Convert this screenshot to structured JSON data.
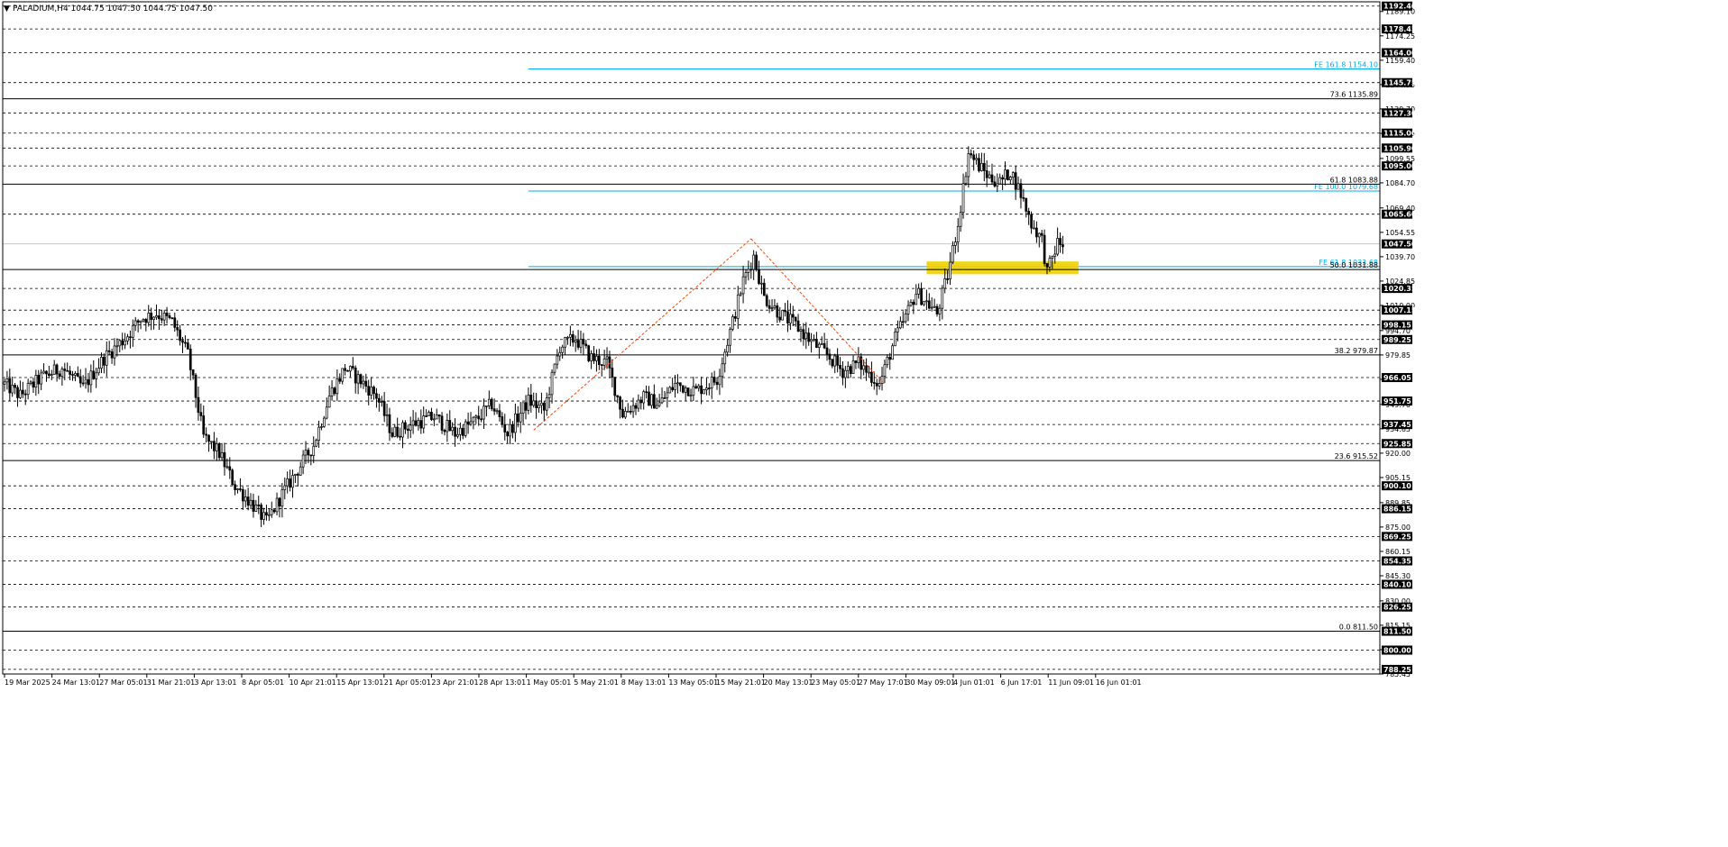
{
  "header": {
    "arrow_glyph": "▼",
    "symbol_text": "PALADIUM,H4  1044.75 1047.50 1044.75 1047.50"
  },
  "colors": {
    "background": "#ffffff",
    "candle": "#000000",
    "grid_dashed": "#000000",
    "fib_line": "#000000",
    "fe_line": "#00aeef",
    "zone_fill": "#f0d000",
    "zigzag": "#ff4500",
    "label_bg": "#000000",
    "label_text": "#ffffff"
  },
  "chart_data": {
    "type": "candlestick",
    "symbol": "PALADIUM",
    "timeframe": "H4",
    "ylim": [
      785.45,
      1195.0
    ],
    "y_axis_ticks": [
      "1189.10",
      "1174.25",
      "1159.40",
      "1144.55",
      "1129.70",
      "1114.85",
      "1099.55",
      "1084.70",
      "1069.40",
      "1054.55",
      "1039.70",
      "1024.85",
      "1010.00",
      "994.70",
      "979.85",
      "965.00",
      "949.70",
      "934.85",
      "920.00",
      "905.15",
      "889.85",
      "875.00",
      "860.15",
      "845.30",
      "830.00",
      "815.15",
      "800.30",
      "785.45"
    ],
    "x_axis_labels": [
      "19 Mar 2025",
      "24 Mar 13:01",
      "27 Mar 05:01",
      "31 Mar 21:01",
      "3 Apr 13:01",
      "8 Apr 05:01",
      "10 Apr 21:01",
      "15 Apr 13:01",
      "21 Apr 05:01",
      "23 Apr 21:01",
      "28 Apr 13:01",
      "1 May 05:01",
      "5 May 21:01",
      "8 May 13:01",
      "13 May 05:01",
      "15 May 21:01",
      "20 May 13:01",
      "23 May 05:01",
      "27 May 17:01",
      "30 May 09:01",
      "4 Jun 01:01",
      "6 Jun 17:01",
      "11 Jun 09:01",
      "16 Jun 01:01"
    ],
    "horizontal_levels": [
      {
        "label": "1192.40",
        "value": 1192.4
      },
      {
        "label": "1178.45",
        "value": 1178.45
      },
      {
        "label": "1164.00",
        "value": 1164.0
      },
      {
        "label": "1145.75",
        "value": 1145.75
      },
      {
        "label": "1127.30",
        "value": 1127.3
      },
      {
        "label": "1115.00",
        "value": 1115.0
      },
      {
        "label": "1105.90",
        "value": 1105.9
      },
      {
        "label": "1095.00",
        "value": 1095.0
      },
      {
        "label": "1065.60",
        "value": 1065.6
      },
      {
        "label": "1020.35",
        "value": 1020.35
      },
      {
        "label": "1007.15",
        "value": 1007.15
      },
      {
        "label": "998.15",
        "value": 998.15
      },
      {
        "label": "989.25",
        "value": 989.25
      },
      {
        "label": "966.05",
        "value": 966.05
      },
      {
        "label": "951.75",
        "value": 951.75
      },
      {
        "label": "937.45",
        "value": 937.45
      },
      {
        "label": "925.85",
        "value": 925.85
      },
      {
        "label": "900.10",
        "value": 900.1
      },
      {
        "label": "886.15",
        "value": 886.15
      },
      {
        "label": "869.25",
        "value": 869.25
      },
      {
        "label": "854.35",
        "value": 854.35
      },
      {
        "label": "840.10",
        "value": 840.1
      },
      {
        "label": "826.25",
        "value": 826.25
      },
      {
        "label": "811.50",
        "value": 811.5
      },
      {
        "label": "800.00",
        "value": 800.0
      },
      {
        "label": "788.25",
        "value": 788.25
      }
    ],
    "fib_levels": [
      {
        "label": "73.6 1135.89",
        "value": 1135.89
      },
      {
        "label": "61.8 1083.88",
        "value": 1083.88
      },
      {
        "label": "50.0 1031.88",
        "value": 1031.88
      },
      {
        "label": "38.2 979.87",
        "value": 979.87
      },
      {
        "label": "23.6 915.52",
        "value": 915.52
      },
      {
        "label": "0.0 811.50",
        "value": 811.5
      }
    ],
    "fe_levels": [
      {
        "label": "FE 161.8 1154.10",
        "value": 1154.1
      },
      {
        "label": "FE 100.0 1079.68",
        "value": 1079.68
      },
      {
        "label": "FE 61.8 1033.68",
        "value": 1033.68
      }
    ],
    "current_price": {
      "label": "1047.50",
      "value": 1047.5
    },
    "zone": {
      "low": 1029.0,
      "high": 1036.8,
      "start_index": 352,
      "end_index": 410
    },
    "zigzag": [
      [
        202,
        934
      ],
      [
        285,
        1050.6
      ],
      [
        336,
        962
      ]
    ],
    "fe_start_index": 200,
    "candle_count": 420,
    "price_path": [
      [
        0,
        962
      ],
      [
        6,
        955
      ],
      [
        14,
        966
      ],
      [
        22,
        972
      ],
      [
        30,
        960
      ],
      [
        38,
        978
      ],
      [
        46,
        990
      ],
      [
        52,
        1002
      ],
      [
        58,
        1005
      ],
      [
        64,
        1000
      ],
      [
        70,
        980
      ],
      [
        76,
        930
      ],
      [
        82,
        920
      ],
      [
        88,
        900
      ],
      [
        94,
        890
      ],
      [
        100,
        878
      ],
      [
        106,
        895
      ],
      [
        112,
        910
      ],
      [
        118,
        925
      ],
      [
        124,
        955
      ],
      [
        130,
        972
      ],
      [
        136,
        964
      ],
      [
        142,
        955
      ],
      [
        148,
        932
      ],
      [
        156,
        938
      ],
      [
        164,
        942
      ],
      [
        172,
        932
      ],
      [
        180,
        940
      ],
      [
        186,
        950
      ],
      [
        192,
        932
      ],
      [
        200,
        952
      ],
      [
        206,
        946
      ],
      [
        212,
        985
      ],
      [
        218,
        990
      ],
      [
        224,
        978
      ],
      [
        230,
        975
      ],
      [
        236,
        944
      ],
      [
        244,
        954
      ],
      [
        250,
        950
      ],
      [
        256,
        962
      ],
      [
        264,
        958
      ],
      [
        272,
        965
      ],
      [
        278,
        1000
      ],
      [
        282,
        1025
      ],
      [
        286,
        1040
      ],
      [
        290,
        1015
      ],
      [
        296,
        1005
      ],
      [
        302,
        998
      ],
      [
        308,
        988
      ],
      [
        314,
        980
      ],
      [
        320,
        970
      ],
      [
        326,
        975
      ],
      [
        334,
        962
      ],
      [
        340,
        990
      ],
      [
        344,
        1003
      ],
      [
        348,
        1018
      ],
      [
        352,
        1012
      ],
      [
        356,
        1005
      ],
      [
        360,
        1028
      ],
      [
        364,
        1060
      ],
      [
        368,
        1103
      ],
      [
        372,
        1095
      ],
      [
        376,
        1088
      ],
      [
        380,
        1085
      ],
      [
        384,
        1092
      ],
      [
        388,
        1078
      ],
      [
        392,
        1060
      ],
      [
        396,
        1050
      ],
      [
        398,
        1030
      ],
      [
        402,
        1048
      ],
      [
        404,
        1047.5
      ]
    ]
  }
}
